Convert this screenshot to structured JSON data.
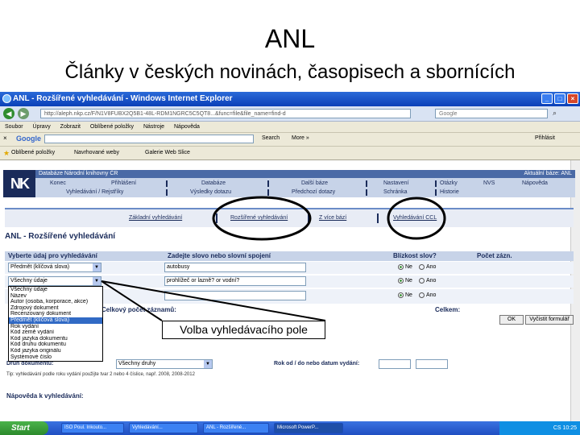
{
  "slide": {
    "title": "ANL",
    "subtitle": "Články v českých novinách, časopisech a sbornících"
  },
  "window": {
    "title": "ANL - Rozšířené vyhledávání - Windows Internet Explorer",
    "min_glyph": "_",
    "max_glyph": "□",
    "close_glyph": "×"
  },
  "address": {
    "url": "http://aleph.nkp.cz/F/N1V8FUBX2Q5B1-48L-RDM1NGRC5C5QT8...&func=file&file_name=find-d",
    "google_placeholder": "Google"
  },
  "menu": [
    "Soubor",
    "Úpravy",
    "Zobrazit",
    "Oblíbené položky",
    "Nástroje",
    "Nápověda"
  ],
  "google_bar": {
    "logo": "Google",
    "search": "Search",
    "more": "More »",
    "login": "Přihlásit"
  },
  "favorites": {
    "label": "Oblíbené položky",
    "items": [
      "Navrhované weby",
      "Galerie Web Slice"
    ]
  },
  "nk": {
    "logo": "NK",
    "banner": "Databáze Národní knihovny ČR",
    "current_db": "Aktuální báze: ANL",
    "row1": [
      "Konec",
      "Přihlášení",
      "Databáze",
      "Další báze",
      "Nastavení",
      "Otázky",
      "NVS",
      "Nápověda"
    ],
    "row2": [
      "Vyhledávání / Rejstříky",
      "Výsledky dotazu",
      "Předchozí dotazy",
      "Schránka",
      "Historie"
    ]
  },
  "search_tabs": [
    "Základní vyhledávání",
    "Rozšířené vyhledávání",
    "Z více bází",
    "Vyhledávání CCL"
  ],
  "page_title": "ANL - Rozšířené vyhledávání",
  "form": {
    "headers": {
      "field": "Vyberte údaj pro vyhledávání",
      "words": "Zadejte slovo nebo slovní spojení",
      "proximity": "Blízkost slov?",
      "count": "Počet zázn."
    },
    "rows": [
      {
        "field": "Předmět (klíčová slova)",
        "words": "autobusy",
        "ne": "Ne",
        "ano": "Ano"
      },
      {
        "field": "Všechny údaje",
        "words": "prohlížeč or lazně? or vodní?",
        "ne": "Ne",
        "ano": "Ano"
      }
    ],
    "total_label": "Celkový počet záznamů:",
    "celkem_label": "Celkem:",
    "ok_button": "OK",
    "clear_button": "Vyčistit formulář"
  },
  "dropdown_options": [
    "Všechny údaje",
    "Název",
    "Autor (osoba, korporace, akce)",
    "Zdrojový dokument",
    "Recenzovaný dokument",
    "Předmět (klíčová slova)",
    "Rok vydání",
    "Kód země vydání",
    "Kód jazyka dokumentu",
    "Kód druhu dokumentu",
    "Kód jazyka originálu",
    "Systémové číslo"
  ],
  "filters": {
    "druh_label": "Druh dokumentu:",
    "druh_value": "Všechny druhy",
    "rok_label": "Rok od / do nebo datum vydání:",
    "hint": "Tip: vyhledávání podle roku vydání použijte tvar 2 nebo 4 číslice, např. 2008, 2008-2012"
  },
  "help_title": "Nápověda k vyhledávání:",
  "callout": "Volba vyhledávacího pole",
  "taskbar": {
    "start": "Start",
    "tasks": [
      "ISO Poul. Inkouto...",
      "Vyhledávání...",
      "ANL - Rozšířené...",
      "Microsoft PowerP..."
    ],
    "tray": "CS  10:25"
  }
}
